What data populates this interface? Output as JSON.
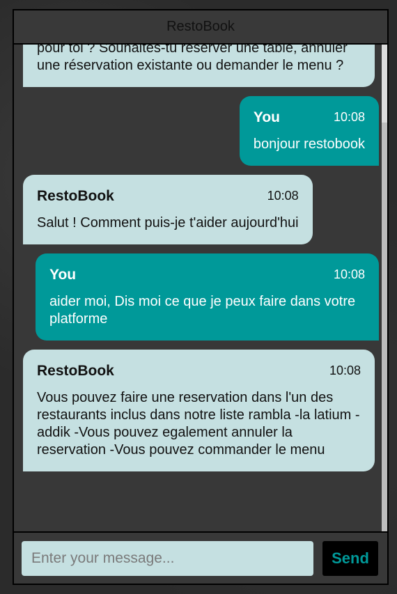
{
  "app": {
    "title": "RestoBook"
  },
  "colors": {
    "accent": "#009999",
    "bot_bubble": "#c5e0e1",
    "panel": "#383838"
  },
  "messages": [
    {
      "sender": "",
      "time": "",
      "text": "pour toi ? Souhaites-tu réserver une table, annuler une réservation existante ou demander le menu ?",
      "role": "bot"
    },
    {
      "sender": "You",
      "time": "10:08",
      "text": "bonjour restobook",
      "role": "user"
    },
    {
      "sender": "RestoBook",
      "time": "10:08",
      "text": "Salut ! Comment puis-je t'aider aujourd'hui",
      "role": "bot"
    },
    {
      "sender": "You",
      "time": "10:08",
      "text": "aider moi, Dis moi ce que je peux faire dans votre platforme",
      "role": "user"
    },
    {
      "sender": "RestoBook",
      "time": "10:08",
      "text": "Vous pouvez faire une reservation dans l'un des restaurants inclus dans notre liste rambla -la latium - addik -Vous pouvez egalement annuler la reservation -Vous pouvez commander le menu",
      "role": "bot"
    }
  ],
  "composer": {
    "placeholder": "Enter your message...",
    "value": "",
    "send_label": "Send"
  }
}
